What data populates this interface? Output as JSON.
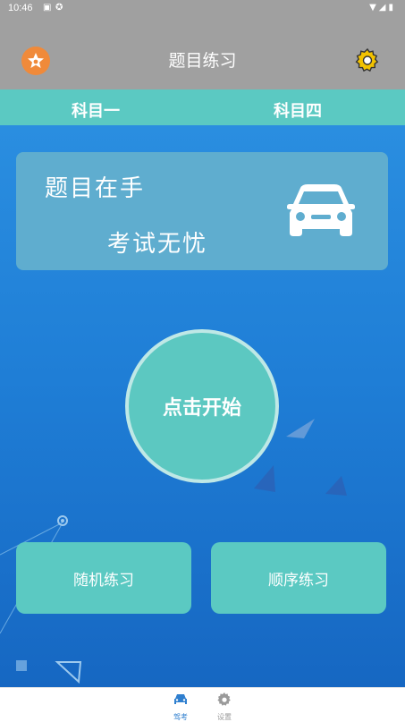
{
  "status_bar": {
    "time": "10:46",
    "left_icons": [
      "sim-icon",
      "app-notification-icon"
    ],
    "right_icons": [
      "wifi-icon",
      "signal-icon",
      "battery-icon"
    ]
  },
  "app_bar": {
    "title": "题目练习",
    "left_icon": "star-badge-icon",
    "right_icon": "gear-icon"
  },
  "tabs": [
    {
      "label": "科目一"
    },
    {
      "label": "科目四"
    }
  ],
  "card": {
    "line1": "题目在手",
    "line2": "考试无忧",
    "icon": "car-icon"
  },
  "start_button": {
    "label": "点击开始"
  },
  "practice_buttons": {
    "random": "随机练习",
    "order": "顺序练习"
  },
  "bottom_nav": {
    "items": [
      {
        "label": "驾考",
        "icon": "car-icon"
      },
      {
        "label": "设置",
        "icon": "gear-icon"
      }
    ]
  },
  "colors": {
    "teal": "#5bc9c2",
    "blue_bg": "#1f7ed6",
    "gray_bar": "#a0a0a0",
    "orange": "#f08a3a",
    "gear_yellow": "#f2c200"
  }
}
